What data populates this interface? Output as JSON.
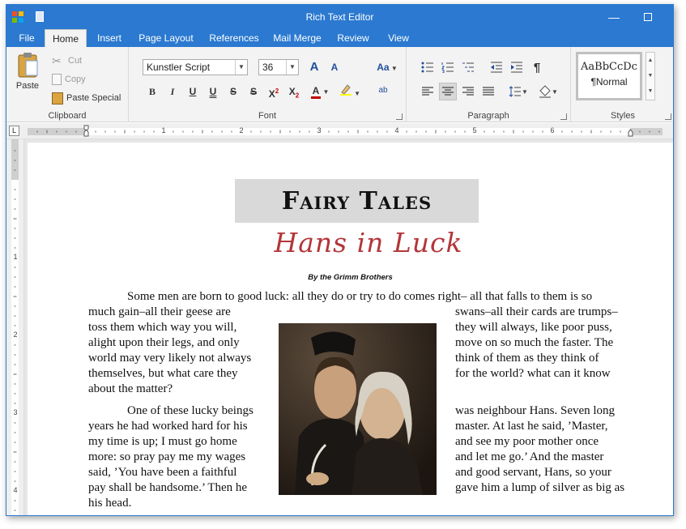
{
  "window": {
    "title": "Rich Text Editor"
  },
  "tabs": [
    "File",
    "Home",
    "Insert",
    "Page Layout",
    "References",
    "Mail Merge",
    "Review",
    "View"
  ],
  "active_tab": "Home",
  "ribbon": {
    "clipboard": {
      "label": "Clipboard",
      "paste": "Paste",
      "cut": "Cut",
      "copy": "Copy",
      "paste_special": "Paste Special"
    },
    "font": {
      "label": "Font",
      "name": "Kunstler Script",
      "size": "36",
      "grow": "A",
      "shrink": "A",
      "change_case": "Aa",
      "bold": "B",
      "italic": "I",
      "underline": "U",
      "double_underline": "U",
      "strike": "S",
      "double_strike": "S",
      "superscript": "X",
      "superscript_mark": "2",
      "subscript": "X",
      "subscript_mark": "2",
      "font_color": "A",
      "ab": "ab"
    },
    "paragraph": {
      "label": "Paragraph",
      "pilcrow": "¶"
    },
    "styles": {
      "label": "Styles",
      "preview": "AaBbCcDc",
      "name": "¶Normal"
    }
  },
  "ruler": {
    "corner": "L",
    "numbers": [
      "1",
      "2",
      "3",
      "4",
      "5",
      "6"
    ]
  },
  "vruler": {
    "numbers": [
      "1",
      "2",
      "3",
      "4"
    ]
  },
  "document": {
    "title": "Fairy Tales",
    "subtitle": "Hans in Luck",
    "byline": "By the Grimm Brothers",
    "lines": [
      "Some men are born to good luck: all they do or try to do comes right– all that falls to them is so",
      "much gain–all their geese are",
      "swans–all their cards are trumps–",
      "toss them which way you will,",
      "they will always, like poor puss,",
      "alight upon their legs, and only",
      "move on so much the faster. The",
      "world may very likely not always",
      "think of them as they think of",
      "themselves, but what care they",
      "for the world? what can it know",
      "about the matter?",
      "One of these lucky beings",
      "was neighbour Hans. Seven long",
      "years he had worked hard for his",
      "master. At last he said, ’Master,",
      "my time is up; I must go home",
      "and see my poor mother once",
      "more: so pray pay me my wages",
      "and let me go.’ And the master",
      "said, ’You have been a faithful",
      "and good servant, Hans, so your",
      "pay shall be handsome.’ Then he",
      "gave him a lump of silver as big as",
      "his head."
    ]
  }
}
